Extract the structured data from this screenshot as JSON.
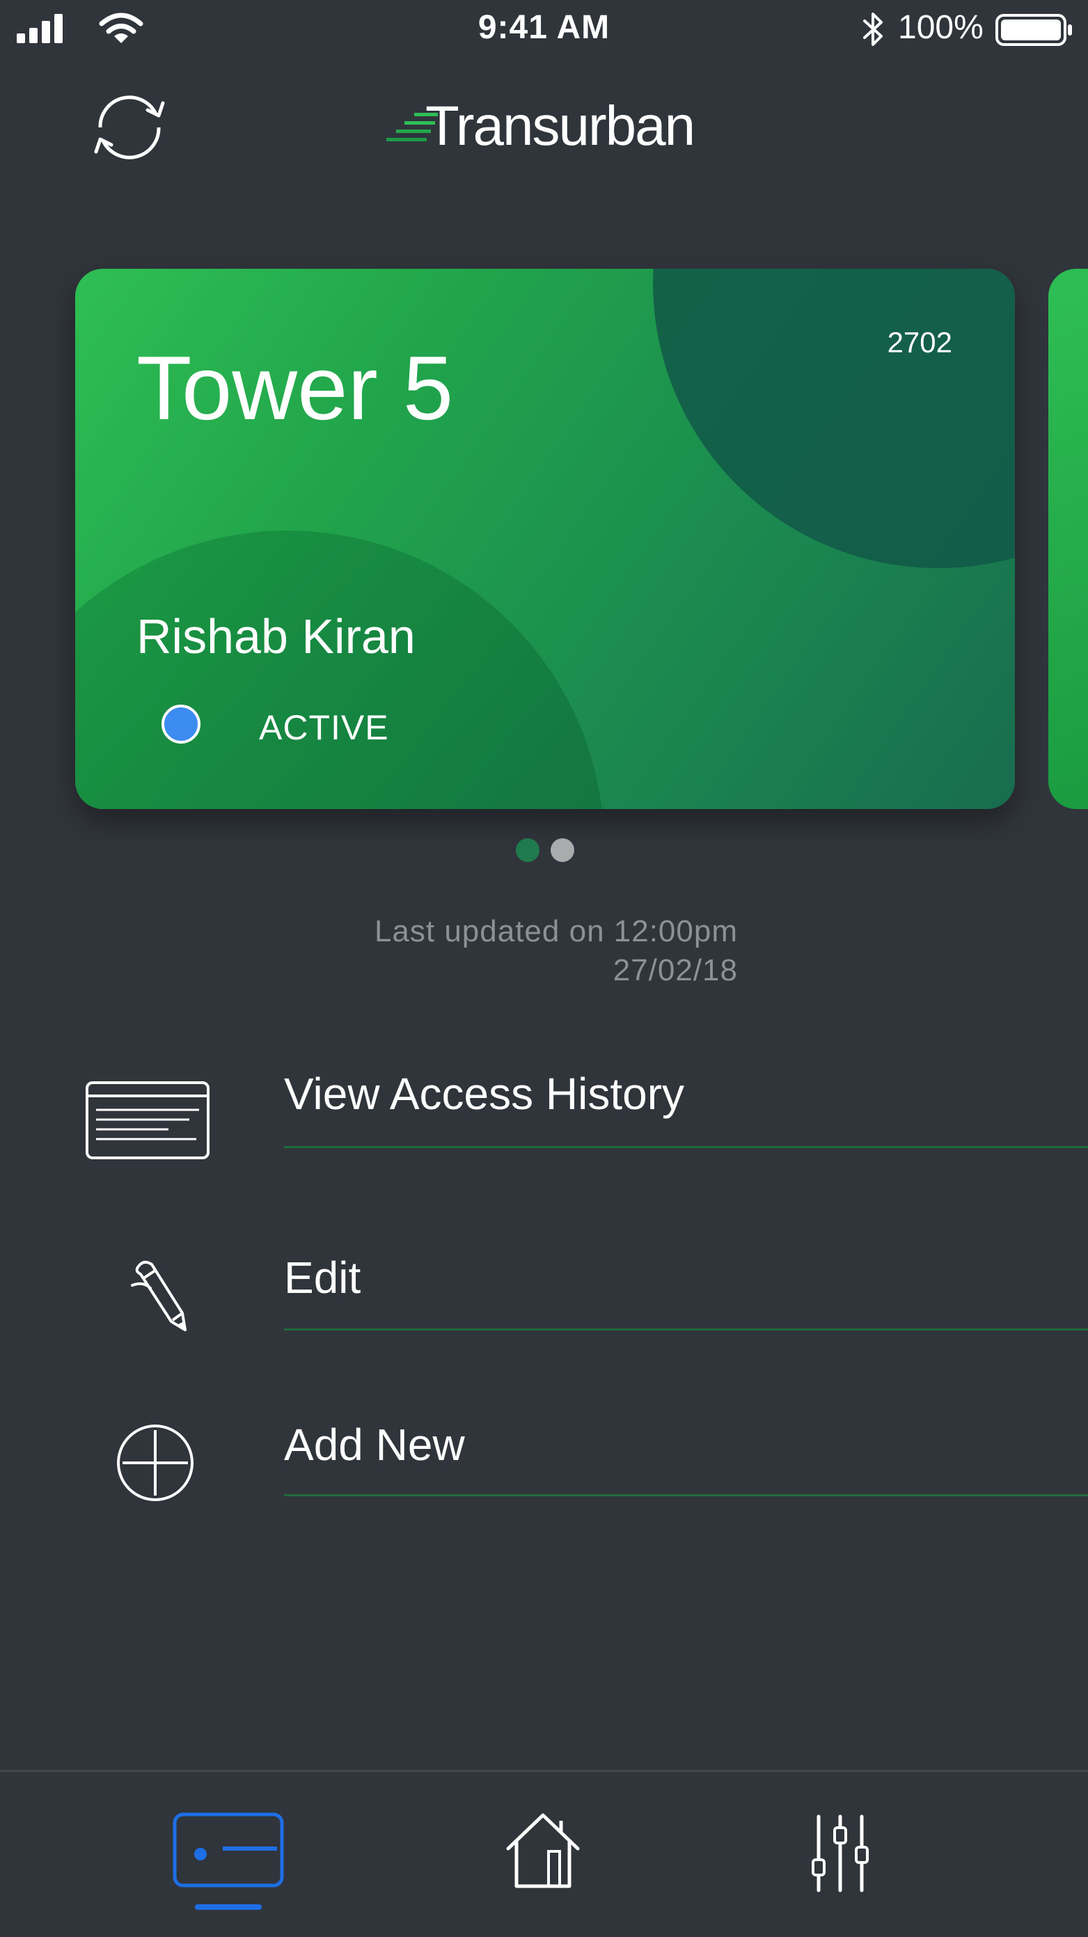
{
  "status_bar": {
    "time": "9:41 AM",
    "battery_percent": "100%",
    "icons": [
      "signal-icon",
      "wifi-icon",
      "bluetooth-icon",
      "battery-icon"
    ]
  },
  "header": {
    "refresh_icon": "refresh-icon",
    "logo_text": "Transurban"
  },
  "card": {
    "title": "Tower 5",
    "number": "2702",
    "holder": "Rishab Kiran",
    "status": "ACTIVE",
    "status_color": "#3d8cf2"
  },
  "pager": {
    "count": 2,
    "active_index": 0
  },
  "updated": {
    "line1": "Last updated on 12:00pm",
    "line2": "27/02/18"
  },
  "menu": {
    "items": [
      {
        "label": "View Access History",
        "icon": "access-history-icon"
      },
      {
        "label": "Edit",
        "icon": "pencil-icon"
      },
      {
        "label": "Add New",
        "icon": "plus-circle-icon"
      }
    ]
  },
  "tab_bar": {
    "tabs": [
      {
        "icon": "card-icon",
        "active": true
      },
      {
        "icon": "home-icon",
        "active": false
      },
      {
        "icon": "sliders-icon",
        "active": false
      }
    ],
    "active_color": "#1e6fe6"
  },
  "colors": {
    "background": "#30353b",
    "brand_green": "#2fbe55",
    "divider_green": "#1f6b3d",
    "muted_text": "#8c9196"
  }
}
